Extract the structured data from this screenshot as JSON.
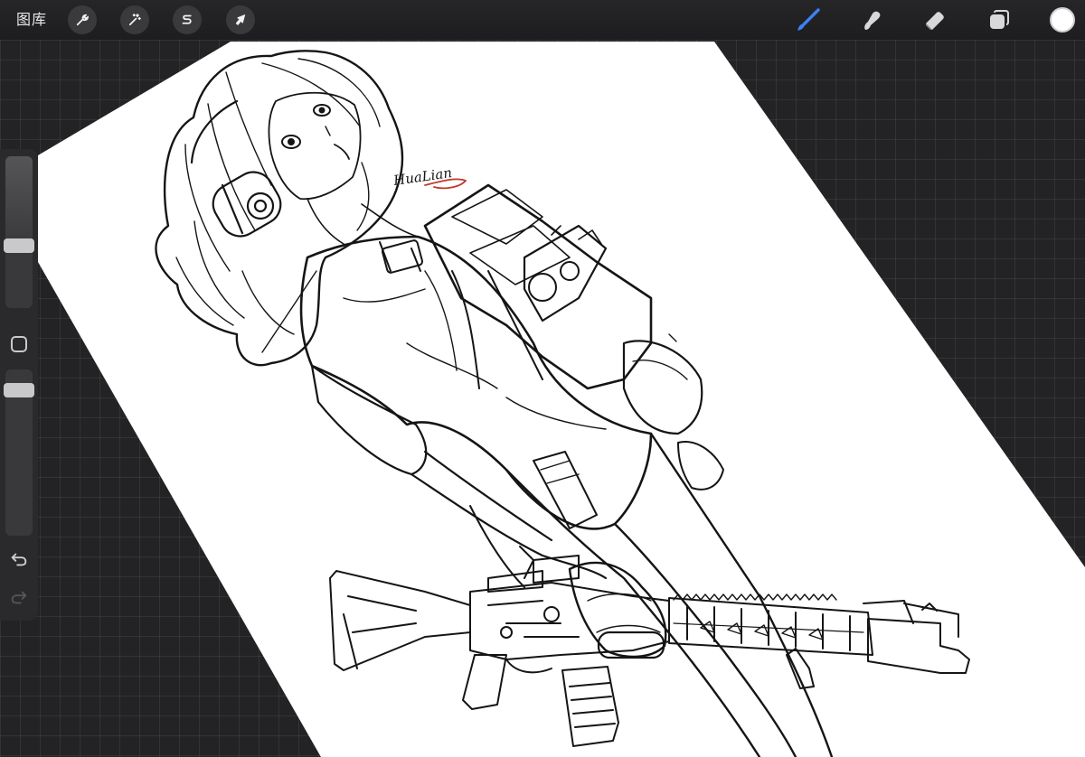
{
  "toolbar": {
    "gallery_label": "图库",
    "left_tools": [
      {
        "icon": "wrench-icon",
        "name": "actions"
      },
      {
        "icon": "magic-wand-icon",
        "name": "adjustments"
      },
      {
        "icon": "selection-s-icon",
        "name": "selection"
      },
      {
        "icon": "arrow-cursor-icon",
        "name": "transform"
      }
    ],
    "right_tools": [
      {
        "icon": "brush-icon",
        "name": "paint",
        "active": true
      },
      {
        "icon": "smudge-icon",
        "name": "smudge",
        "active": false
      },
      {
        "icon": "eraser-icon",
        "name": "erase",
        "active": false
      },
      {
        "icon": "layers-icon",
        "name": "layers",
        "active": false
      }
    ],
    "current_color": "#ffffff",
    "active_tool_color": "#3b82f6"
  },
  "sidebar": {
    "brush_size": 0.6,
    "brush_opacity": 1.0,
    "icons": [
      "modify-square-icon",
      "undo-icon",
      "redo-icon"
    ]
  },
  "colors": {
    "canvas_background": "#232325",
    "paper": "#ffffff",
    "ink": "#111111",
    "signature_red": "#c0392b"
  },
  "canvas": {
    "signature": "HuaLian"
  }
}
